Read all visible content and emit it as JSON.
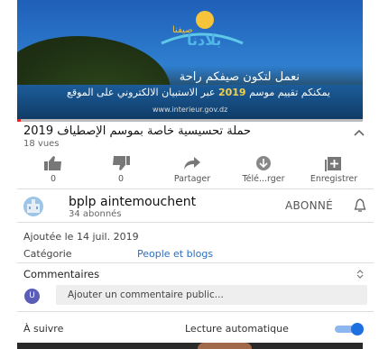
{
  "video": {
    "logo_small": "صيفنا",
    "logo_big": "بلادنا",
    "line1": "نعمل لتكون صيفكم راحة",
    "line2_pre": "يمكنكم تقييم موسم",
    "line2_year": "2019",
    "line2_post": "عبر الاستبيان الالكتروني على الموقع",
    "url": "www.interieur.gov.dz",
    "progress": 0.01
  },
  "title": "حملة تحسيسية خاصة بموسم الإصطياف 2019",
  "views": "18 vues",
  "actions": [
    {
      "icon": "thumbs-up-icon",
      "label": "0"
    },
    {
      "icon": "thumbs-down-icon",
      "label": "0"
    },
    {
      "icon": "share-icon",
      "label": "Partager"
    },
    {
      "icon": "download-icon",
      "label": "Télé...rger"
    },
    {
      "icon": "add-to-playlist-icon",
      "label": "Enregistrer"
    }
  ],
  "channel": {
    "name": "bplp aintemouchent",
    "subscribers": "34 abonnés",
    "subscribe_label": "ABONNÉ",
    "bell_icon": "bell-icon"
  },
  "meta": {
    "added": "Ajoutée le 14 juil. 2019",
    "category_label": "Catégorie",
    "category_value": "People et blogs"
  },
  "comments": {
    "heading": "Commentaires",
    "avatar_letter": "U",
    "placeholder": "Ajouter un commentaire public..."
  },
  "next": {
    "label": "À suivre",
    "autoplay_label": "Lecture automatique",
    "autoplay_on": true
  },
  "colors": {
    "accent": "#1e6fe0",
    "link": "#2a6fc4",
    "progress": "#e22222"
  }
}
